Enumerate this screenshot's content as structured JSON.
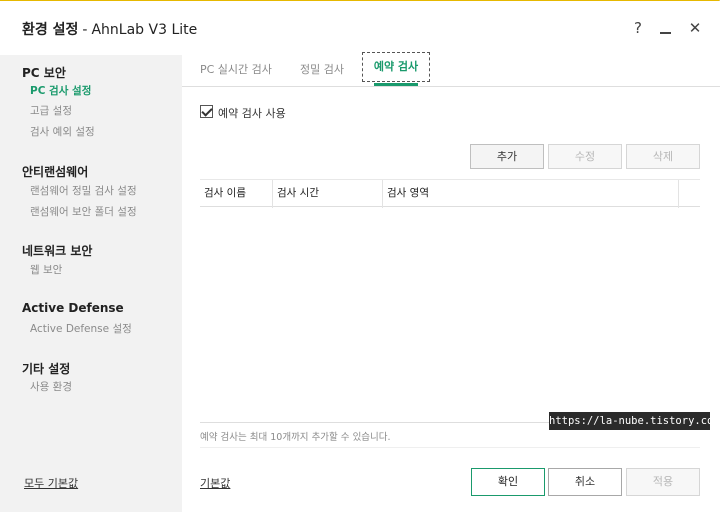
{
  "window": {
    "title_bold": "환경 설정",
    "title_sep": "-",
    "title_app": "AhnLab V3 Lite",
    "help_glyph": "?",
    "close_glyph": "✕"
  },
  "sidebar": {
    "groups": [
      {
        "title": "PC 보안",
        "items": [
          "PC 검사 설정",
          "고급 설정",
          "검사 예외 설정"
        ]
      },
      {
        "title": "안티랜섬웨어",
        "items": [
          "랜섬웨어 정밀 검사 설정",
          "랜섬웨어 보안 폴더 설정"
        ]
      },
      {
        "title": "네트워크 보안",
        "items": [
          "웹 보안"
        ]
      },
      {
        "title": "Active Defense",
        "items": [
          "Active Defense 설정"
        ]
      },
      {
        "title": "기타 설정",
        "items": [
          "사용 환경"
        ]
      }
    ],
    "reset_all": "모두 기본값"
  },
  "tabs": [
    "PC 실시간 검사",
    "정밀 검사",
    "예약 검사"
  ],
  "main": {
    "checkbox_label": "예약 검사 사용",
    "checkbox_checked": true,
    "buttons": {
      "add": "추가",
      "edit": "수정",
      "delete": "삭제"
    },
    "table": {
      "columns": [
        "검사 이름",
        "검사 시간",
        "검사 영역"
      ],
      "rows": []
    },
    "note": "예약 검사는 최대 10개까지 추가할 수 있습니다.",
    "reset": "기본값",
    "ok": "확인",
    "cancel": "취소",
    "apply": "적용"
  },
  "watermark": "https://la-nube.tistory.com",
  "colors": {
    "accent": "#1a9a6c",
    "sidebar_bg": "#f2f2f2"
  }
}
